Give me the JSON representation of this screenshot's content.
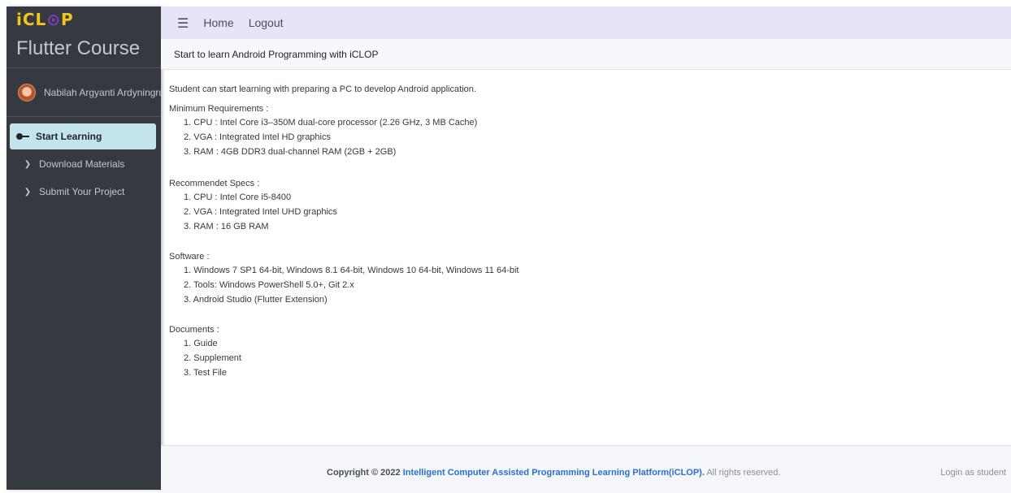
{
  "sidebar": {
    "logo": {
      "prefix": "iCL",
      "o": "⊙",
      "suffix": "P"
    },
    "brand_text": "Flutter Course",
    "user_name": "Nabilah Argyanti Ardyningrum",
    "items": [
      {
        "label": "Start Learning",
        "active": true,
        "icon": "key-icon"
      },
      {
        "label": "Download Materials",
        "active": false,
        "icon": "chevron-right-icon"
      },
      {
        "label": "Submit Your Project",
        "active": false,
        "icon": "chevron-right-icon"
      }
    ]
  },
  "topbar": {
    "menu_icon": "hamburger-icon",
    "home": "Home",
    "logout": "Logout"
  },
  "header": {
    "title": "Start to learn Android Programming with iCLOP"
  },
  "main": {
    "intro": "Student can start learning with preparing a PC to develop Android application.",
    "sections": [
      {
        "title": "Minimum Requirements :",
        "items": [
          "1. CPU : Intel Core i3–350M dual-core processor (2.26 GHz, 3 MB Cache)",
          "2. VGA : Integrated Intel HD graphics",
          "3. RAM : 4GB DDR3 dual-channel RAM (2GB + 2GB)"
        ]
      },
      {
        "title": "Recommendet Specs :",
        "items": [
          "1. CPU : Intel Core i5-8400",
          "2. VGA : Integrated Intel UHD graphics",
          "3. RAM : 16 GB RAM"
        ]
      },
      {
        "title": "Software :",
        "items": [
          "1. Windows 7 SP1 64-bit, Windows 8.1 64-bit, Windows 10 64-bit, Windows 11 64-bit",
          "2. Tools: Windows PowerShell 5.0+, Git 2.x",
          "3. Android Studio (Flutter Extension)"
        ]
      },
      {
        "title": "Documents :",
        "items": [
          "1. Guide",
          "2. Supplement",
          "3. Test File"
        ]
      }
    ]
  },
  "footer": {
    "copyright_prefix": "Copyright © 2022 ",
    "brand_link": "Intelligent Computer Assisted Programming Learning Platform(iCLOP).",
    "rights": " All rights reserved.",
    "login_as": "Login as student"
  },
  "colors": {
    "sidebar_bg": "#343a40",
    "active_item_bg": "#c2e4ea",
    "topbar_bg": "#e6e4f6",
    "link": "#2a6fd6"
  }
}
